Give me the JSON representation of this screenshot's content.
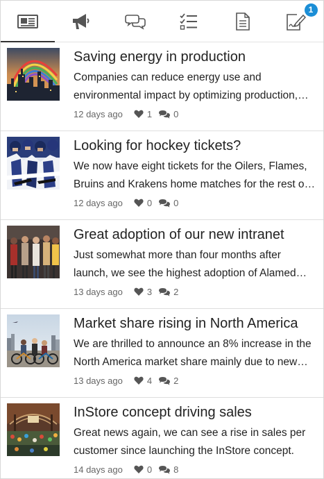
{
  "tabs": [
    {
      "icon": "news-icon",
      "active": true
    },
    {
      "icon": "megaphone-icon",
      "active": false
    },
    {
      "icon": "chat-bubbles-icon",
      "active": false
    },
    {
      "icon": "checklist-icon",
      "active": false
    },
    {
      "icon": "document-icon",
      "active": false
    },
    {
      "icon": "signed-document-icon",
      "active": false,
      "badge": "1"
    }
  ],
  "colors": {
    "badge": "#1b8ed6",
    "icon": "#555555",
    "meta": "#666666"
  },
  "items": [
    {
      "title": "Saving energy in production",
      "excerpt": "Companies can reduce energy use and environmental impact by optimizing production, and other processes.",
      "date": "12 days ago",
      "likes": "1",
      "comments": "0",
      "thumbnail": "city-rainbow"
    },
    {
      "title": "Looking for hockey tickets?",
      "excerpt": "We now have eight tickets for the Oilers, Flames, Bruins and Krakens home matches for the rest of the season.",
      "date": "12 days ago",
      "likes": "0",
      "comments": "0",
      "thumbnail": "hockey-players"
    },
    {
      "title": "Great adoption of our new intranet",
      "excerpt": "Just somewhat more than four months after launch, we see the highest adoption of Alamed intranet ever.",
      "date": "13 days ago",
      "likes": "3",
      "comments": "2",
      "thumbnail": "group-of-people"
    },
    {
      "title": "Market share rising in North America",
      "excerpt": "We are thrilled to announce an 8% increase in the North America market share mainly due to new products.",
      "date": "13 days ago",
      "likes": "4",
      "comments": "2",
      "thumbnail": "cyclists"
    },
    {
      "title": "InStore concept driving sales",
      "excerpt": "Great news again, we can see a rise in sales per customer since launching the InStore concept.",
      "date": "14 days ago",
      "likes": "0",
      "comments": "8",
      "thumbnail": "market-hall"
    }
  ]
}
